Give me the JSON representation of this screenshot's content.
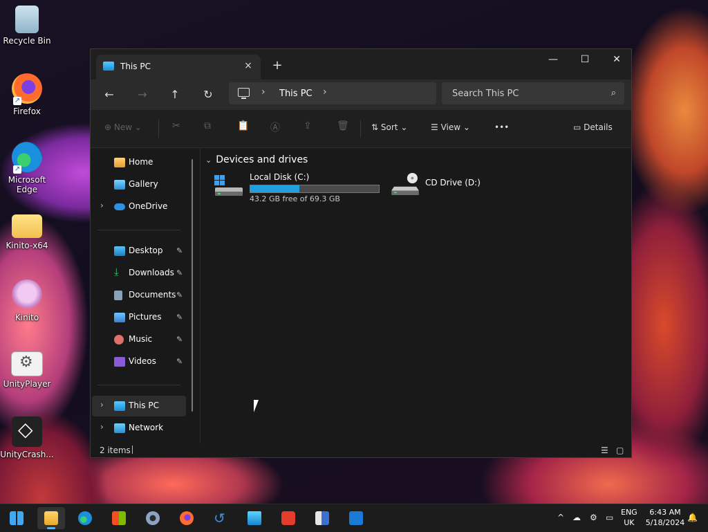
{
  "desktop": {
    "icons": [
      {
        "label": "Recycle Bin"
      },
      {
        "label": "Firefox"
      },
      {
        "label": "Microsoft Edge"
      },
      {
        "label": "Kinito-x64"
      },
      {
        "label": "Kinito"
      },
      {
        "label": "UnityPlayer"
      },
      {
        "label": "UnityCrash..."
      }
    ]
  },
  "window": {
    "tab_title": "This PC",
    "tab_close_icon": "×",
    "new_tab_icon": "+",
    "controls": {
      "minimize": "—",
      "maximize": "☐",
      "close": "✕"
    },
    "nav": {
      "back": "←",
      "forward": "→",
      "up": "↑",
      "refresh": "↻"
    },
    "address": {
      "chevron": "›",
      "crumb": "This PC"
    },
    "search": {
      "placeholder": "Search This PC",
      "icon": "⌕"
    },
    "command_bar": {
      "new_label": "New",
      "sort_label": "Sort",
      "view_label": "View",
      "more_label": "•••",
      "details_label": "Details",
      "dropdown_chevron": "⌄"
    },
    "nav_pane": {
      "top": [
        {
          "label": "Home"
        },
        {
          "label": "Gallery"
        },
        {
          "label": "OneDrive"
        }
      ],
      "quick_access": [
        {
          "label": "Desktop"
        },
        {
          "label": "Downloads"
        },
        {
          "label": "Documents"
        },
        {
          "label": "Pictures"
        },
        {
          "label": "Music"
        },
        {
          "label": "Videos"
        }
      ],
      "bottom": [
        {
          "label": "This PC"
        },
        {
          "label": "Network"
        }
      ],
      "expand_chevron": "›",
      "pin_icon": "📌"
    },
    "content": {
      "group_title": "Devices and drives",
      "group_chevron": "⌄",
      "drives": [
        {
          "name": "Local Disk (C:)",
          "free_text": "43.2 GB free of 69.3 GB",
          "used_fraction": 0.38
        },
        {
          "name": "CD Drive (D:)"
        }
      ]
    },
    "status": {
      "item_count": "2 items"
    }
  },
  "taskbar": {
    "tray_chevron": "^",
    "lang_line1": "ENG",
    "lang_line2": "UK",
    "time": "6:43 AM",
    "date": "5/18/2024",
    "colors": {
      "accent": "#1f9ee0"
    }
  }
}
